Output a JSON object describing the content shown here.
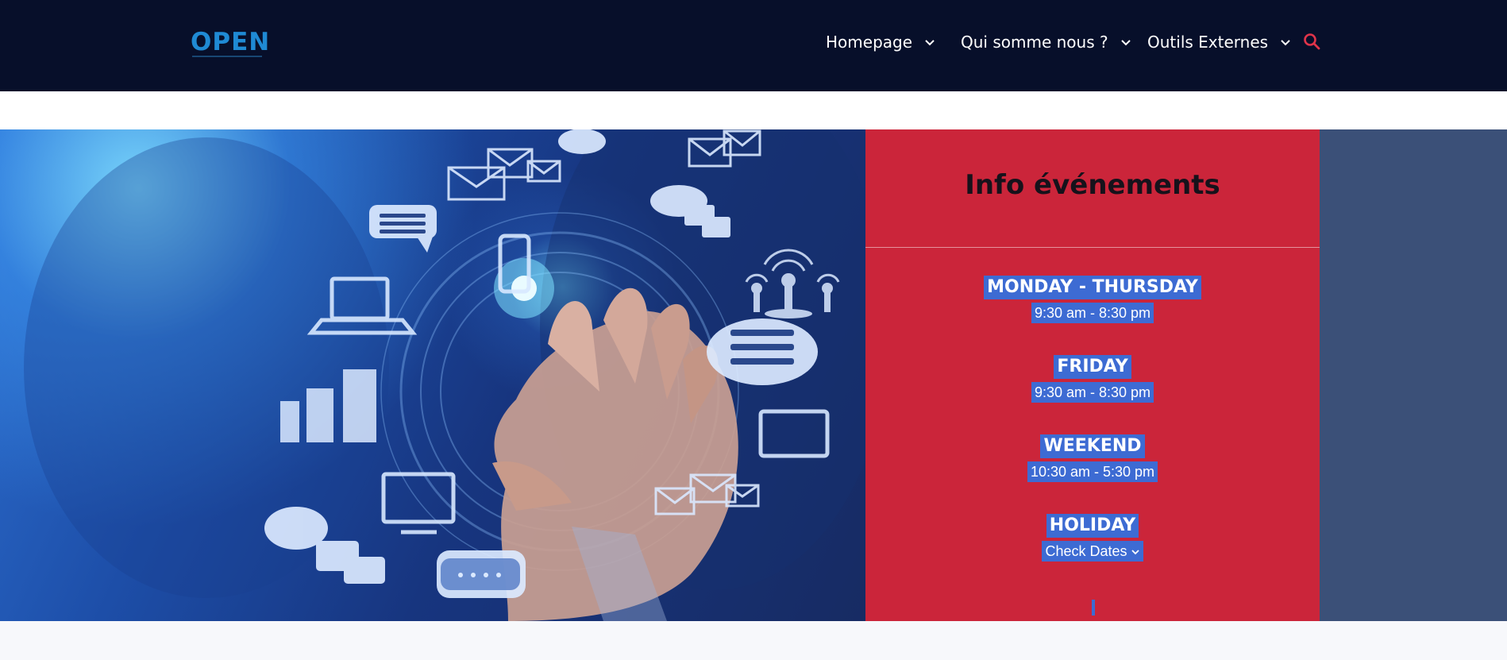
{
  "header": {
    "logo_text": "OPEN",
    "nav": [
      {
        "label": "Homepage"
      },
      {
        "label": "Qui somme nous ?"
      },
      {
        "label": "Outils Externes"
      }
    ],
    "search_icon": "search-icon"
  },
  "info": {
    "title": "Info événements",
    "schedule": [
      {
        "day": "MONDAY - THURSDAY",
        "hours": "9:30 am - 8:30 pm"
      },
      {
        "day": "FRIDAY",
        "hours": "9:30 am - 8:30 pm"
      },
      {
        "day": "WEEKEND",
        "hours": "10:30 am - 5:30 pm"
      },
      {
        "day": "HOLIDAY",
        "hours": "Check Dates"
      }
    ]
  },
  "colors": {
    "topbar": "#070f2a",
    "logo": "#1f8ad4",
    "accent_red": "#cb253a",
    "search_icon": "#e0344a",
    "side_panel": "#3b5078",
    "highlight": "#3d6bd3"
  }
}
